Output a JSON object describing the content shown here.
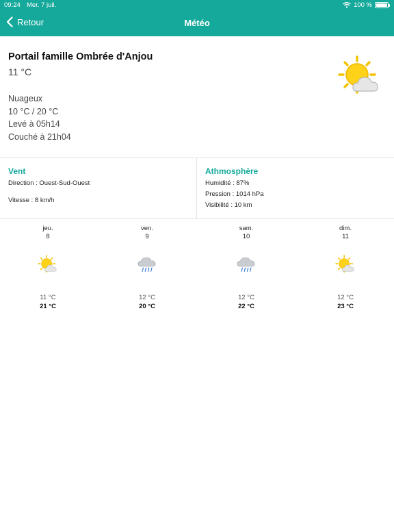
{
  "status_bar": {
    "time": "09:24",
    "date": "Mer. 7 juil.",
    "battery": "100 %"
  },
  "nav": {
    "back_label": "Retour",
    "title": "Météo"
  },
  "current": {
    "place": "Portail famille Ombrée d'Anjou",
    "temperature": "11 °C",
    "condition": "Nuageux",
    "range": "10 °C / 20 °C",
    "sunrise": "Levé à 05h14",
    "sunset": "Couché à 21h04",
    "icon": "sun-cloud-icon"
  },
  "wind": {
    "title": "Vent",
    "direction": "Direction : Ouest-Sud-Ouest",
    "speed": "Vitesse : 8 km/h"
  },
  "atmosphere": {
    "title": "Athmosphère",
    "humidity": "Humidité : 87%",
    "pressure": "Pression : 1014 hPa",
    "visibility": "Visibilité : 10 km"
  },
  "forecast": [
    {
      "day": "jeu.",
      "date": "8",
      "icon": "sun-cloud-icon",
      "min": "11 °C",
      "max": "21 °C"
    },
    {
      "day": "ven.",
      "date": "9",
      "icon": "rain-cloud-icon",
      "min": "12 °C",
      "max": "20 °C"
    },
    {
      "day": "sam.",
      "date": "10",
      "icon": "rain-cloud-icon",
      "min": "12 °C",
      "max": "22 °C"
    },
    {
      "day": "dim.",
      "date": "11",
      "icon": "sun-cloud-icon",
      "min": "12 °C",
      "max": "23 °C"
    }
  ],
  "colors": {
    "accent": "#15a99b",
    "sun": "#f5c400",
    "cloud": "#d9d9d9",
    "rain": "#3a7bd5"
  }
}
